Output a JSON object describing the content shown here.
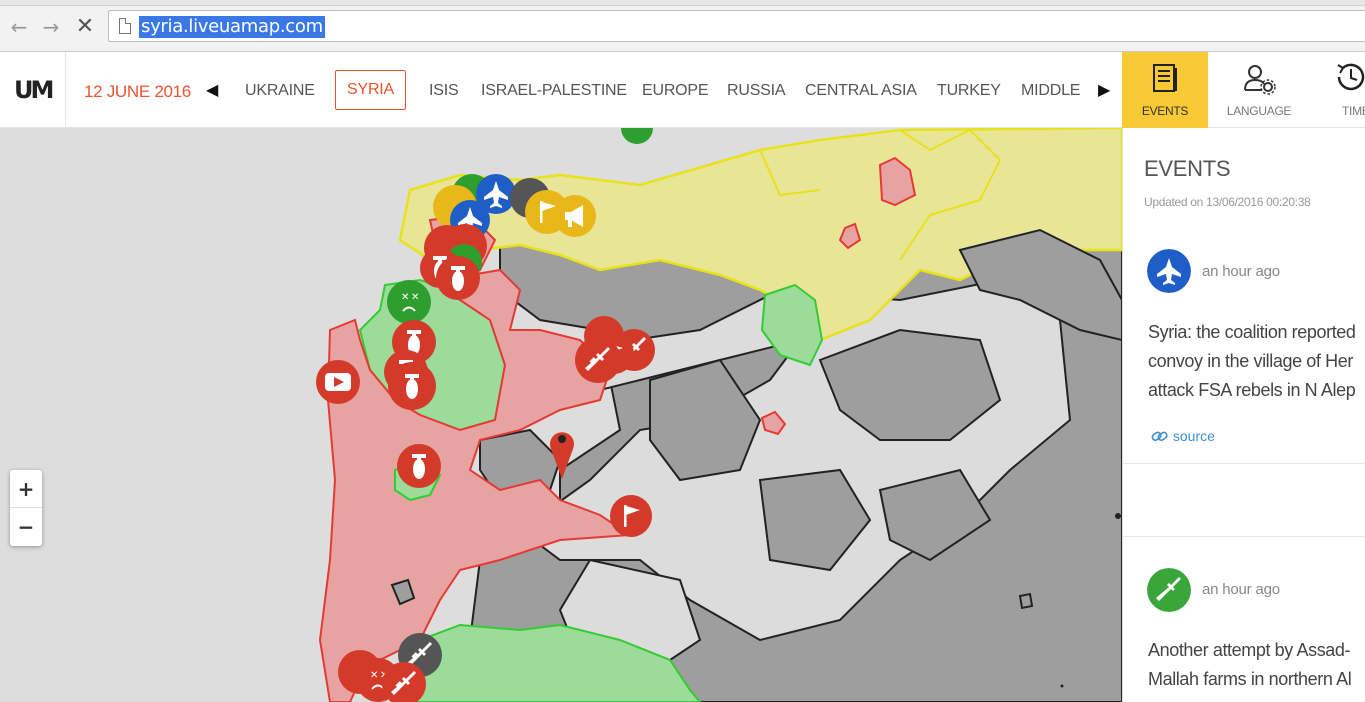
{
  "browser": {
    "url": "syria.liveuamap.com",
    "back_glyph": "←",
    "forward_glyph": "→",
    "stop_glyph": "✕"
  },
  "header": {
    "logo_text": "UM",
    "date": "12 JUNE 2016",
    "arrow_left": "◀",
    "arrow_right": "▶",
    "regions": [
      "UKRAINE",
      "SYRIA",
      "ISIS",
      "ISRAEL-PALESTINE",
      "EUROPE",
      "RUSSIA",
      "CENTRAL ASIA",
      "TURKEY",
      "MIDDLE"
    ],
    "active_region": "SYRIA",
    "panel_buttons": [
      {
        "label": "EVENTS",
        "icon": "events-icon",
        "active": true
      },
      {
        "label": "LANGUAGE",
        "icon": "language-icon",
        "active": false
      },
      {
        "label": "TIME",
        "icon": "clock-icon",
        "active": false
      }
    ]
  },
  "map": {
    "zoom_in": "+",
    "zoom_out": "−",
    "colors": {
      "background": "#dddddd",
      "government": "#e6a3a1",
      "government_border": "#e53935",
      "opposition": "#9cdb9a",
      "opposition_border": "#33cc33",
      "kurdish_turkey": "#e8e597",
      "kurdish_border": "#e8e21a",
      "isis": "#9e9e9e",
      "isis_border": "#222222"
    }
  },
  "events_panel": {
    "title": "EVENTS",
    "updated": "Updated on 13/06/2016 00:20:38",
    "events": [
      {
        "icon": "jet-icon",
        "color": "#1f5ec6",
        "time": "an hour ago",
        "lines": [
          "Syria: the coalition reported",
          "convoy in the village of Her",
          "attack FSA rebels in N Alep"
        ],
        "source": "source"
      },
      {
        "icon": "rifle-icon",
        "color": "#3aa53a",
        "time": "an hour ago",
        "lines": [
          "Another attempt by Assad-",
          "Mallah farms in northern Al"
        ]
      }
    ]
  }
}
